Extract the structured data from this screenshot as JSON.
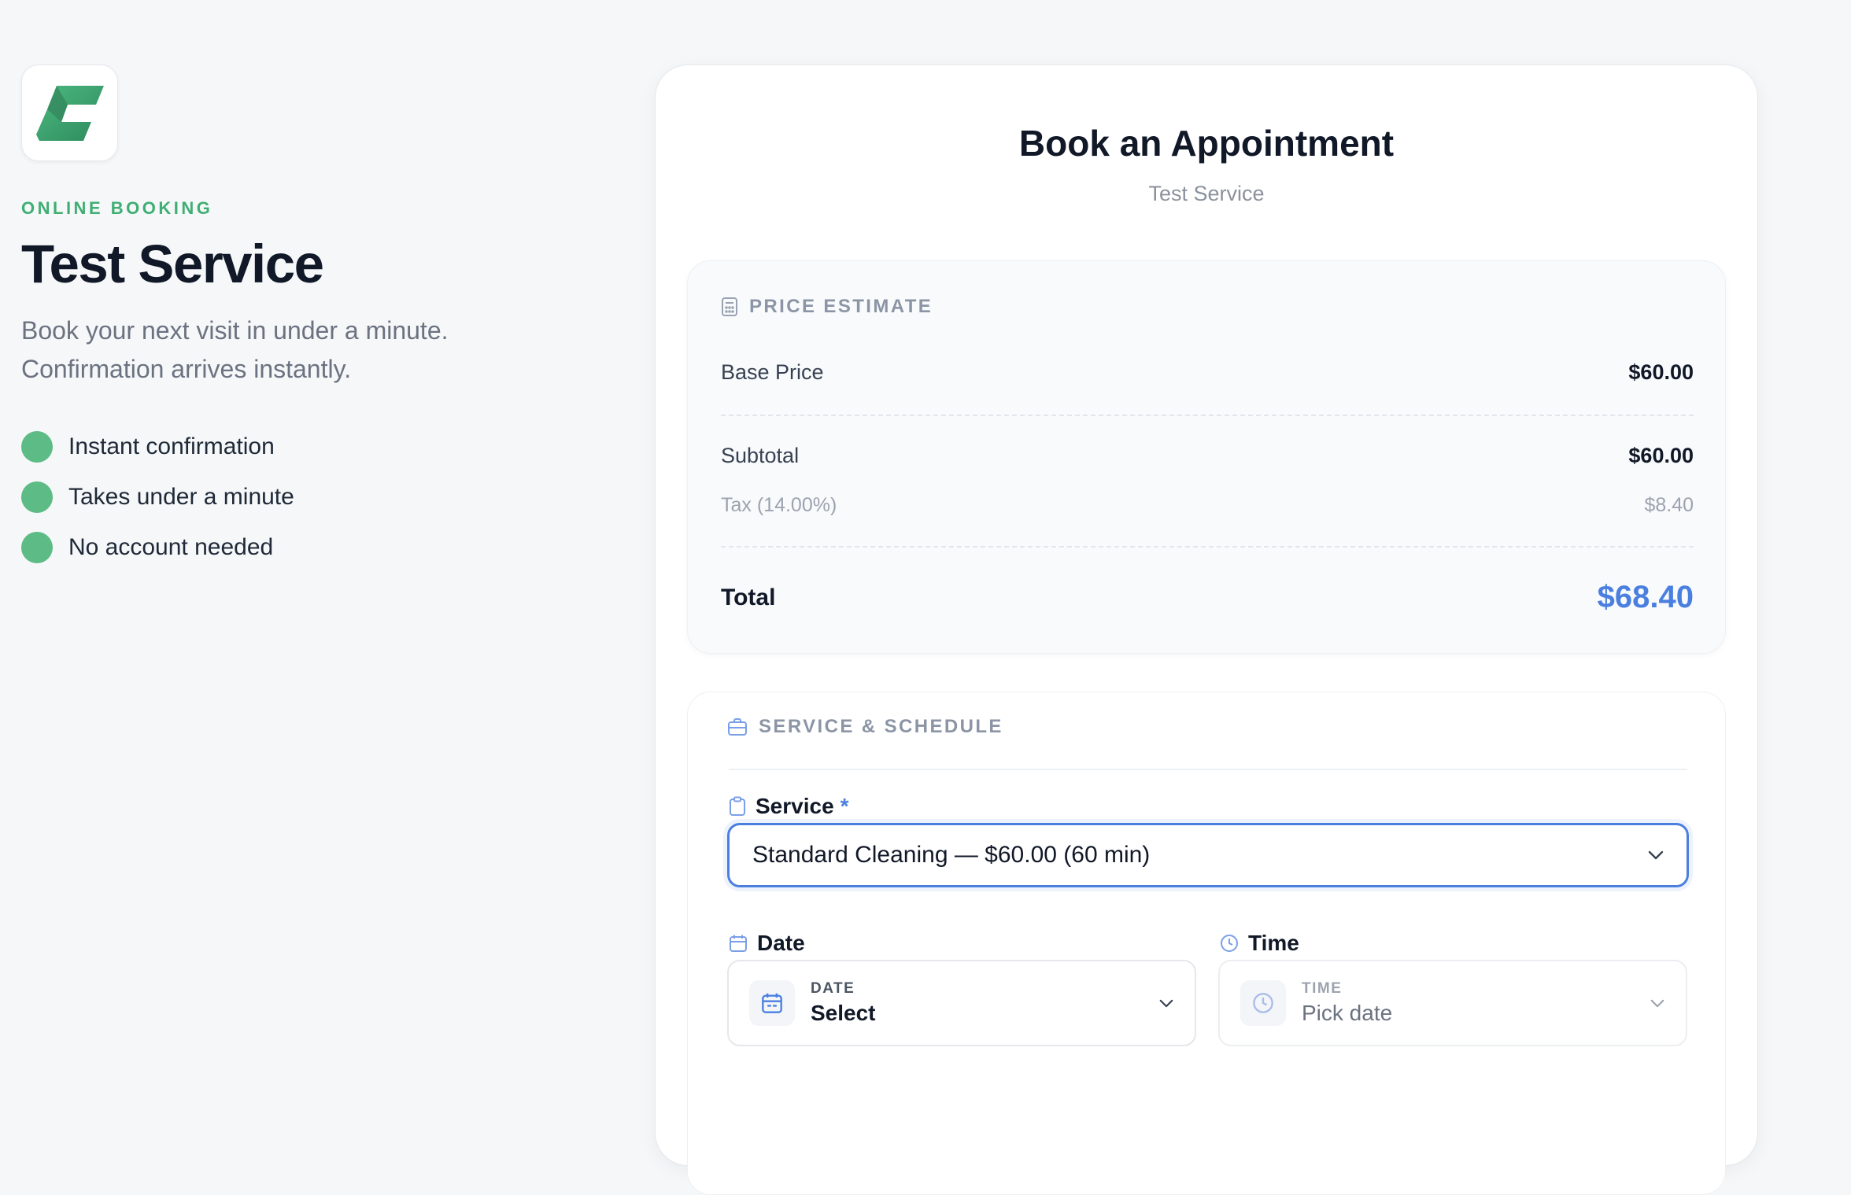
{
  "brand": {
    "eyebrow": "ONLINE BOOKING",
    "title": "Test Service",
    "tagline_line1": "Book your next visit in under a minute.",
    "tagline_line2": "Confirmation arrives instantly.",
    "features": [
      "Instant confirmation",
      "Takes under a minute",
      "No account needed"
    ],
    "colors": {
      "accent_green": "#3fae73",
      "dot_green": "#5dbb85"
    }
  },
  "booking": {
    "title": "Book an Appointment",
    "subtitle": "Test Service",
    "price_estimate": {
      "heading": "PRICE ESTIMATE",
      "base_price_label": "Base Price",
      "base_price_value": "$60.00",
      "subtotal_label": "Subtotal",
      "subtotal_value": "$60.00",
      "tax_label": "Tax (14.00%)",
      "tax_value": "$8.40",
      "total_label": "Total",
      "total_value": "$68.40"
    },
    "schedule": {
      "heading": "SERVICE & SCHEDULE",
      "service_label": "Service",
      "required_mark": "*",
      "service_selected": "Standard Cleaning — $60.00 (60 min)",
      "date_label": "Date",
      "date_caption": "DATE",
      "date_value": "Select",
      "time_label": "Time",
      "time_caption": "TIME",
      "time_value": "Pick date"
    },
    "colors": {
      "primary_blue": "#4a7fe0"
    }
  }
}
